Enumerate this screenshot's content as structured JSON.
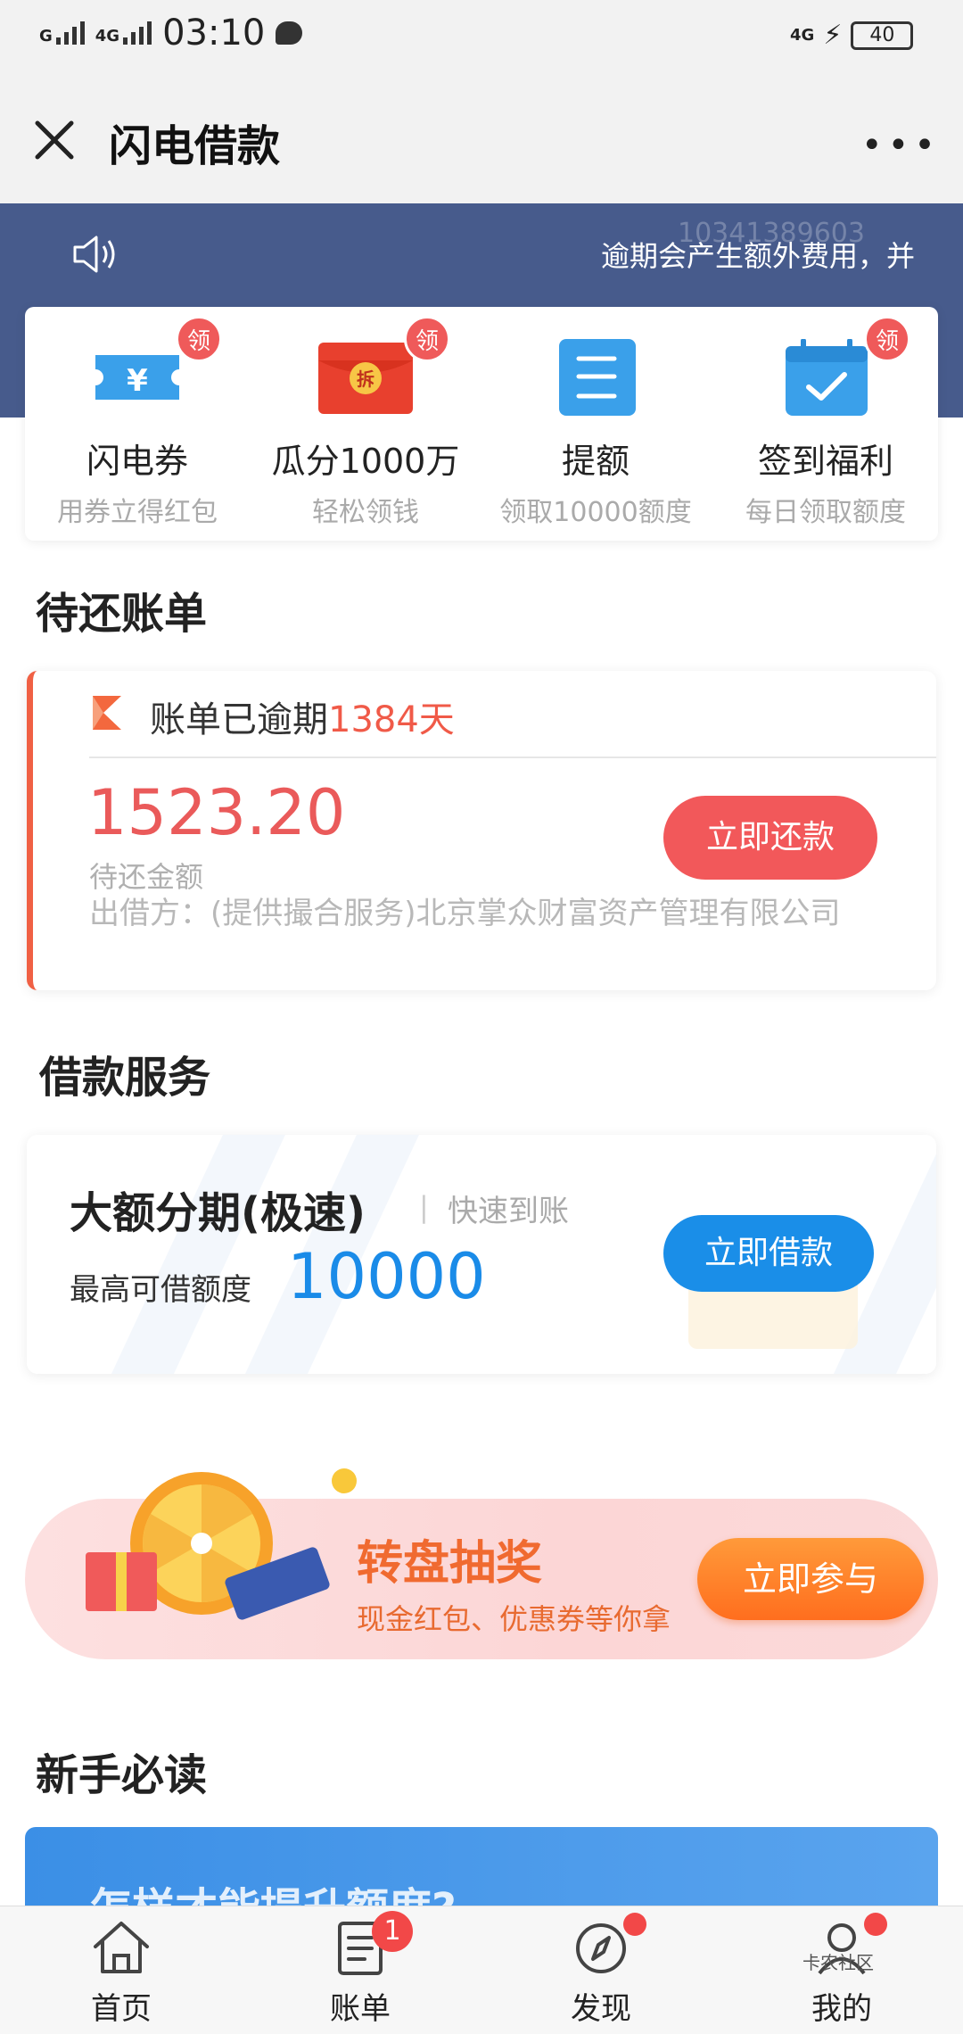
{
  "status_bar": {
    "signal1": "G",
    "signal2": "4G",
    "time": "03:10",
    "network_right": "4G",
    "battery": "40"
  },
  "header": {
    "title": "闪电借款",
    "more_label": "•••"
  },
  "banner": {
    "marquee": "逾期会产生额外费用，并",
    "phone_watermark": "10341389603"
  },
  "quick_actions": [
    {
      "title": "闪电券",
      "subtitle": "用券立得红包",
      "badge": "领",
      "icon": "ticket-icon"
    },
    {
      "title": "瓜分1000万",
      "subtitle": "轻松领钱",
      "badge": "领",
      "icon": "red-envelope-icon"
    },
    {
      "title": "提额",
      "subtitle": "领取10000额度",
      "badge": "",
      "icon": "document-icon"
    },
    {
      "title": "签到福利",
      "subtitle": "每日领取额度",
      "badge": "领",
      "icon": "calendar-check-icon"
    }
  ],
  "pending_bills": {
    "section_title": "待还账单",
    "status_prefix": "账单已逾期",
    "overdue_days": "1384天",
    "amount": "1523.20",
    "amount_label": "待还金额",
    "lender": "出借方：(提供撮合服务)北京掌众财富资产管理有限公司",
    "repay_button": "立即还款"
  },
  "loan_service": {
    "section_title": "借款服务",
    "product": "大额分期(极速)",
    "separator": "|",
    "tag": "快速到账",
    "limit_label": "最高可借额度",
    "limit_value": "10000",
    "borrow_button": "立即借款"
  },
  "lottery": {
    "title": "转盘抽奖",
    "subtitle": "现金红包、优惠券等你拿",
    "button": "立即参与"
  },
  "guide": {
    "section_title": "新手必读",
    "card_text": "怎样才能提升额度?"
  },
  "tabbar": [
    {
      "label": "首页",
      "icon": "home-icon",
      "badge": ""
    },
    {
      "label": "账单",
      "icon": "bill-icon",
      "badge": "1"
    },
    {
      "label": "发现",
      "icon": "compass-icon",
      "badge": "dot"
    },
    {
      "label": "我的",
      "icon": "profile-icon",
      "badge": "dot"
    }
  ],
  "watermark": "卡农社区",
  "colors": {
    "banner": "#475b8c",
    "accent_red": "#f2585a",
    "accent_blue": "#1a8ee8",
    "accent_orange": "#ff7a22"
  }
}
